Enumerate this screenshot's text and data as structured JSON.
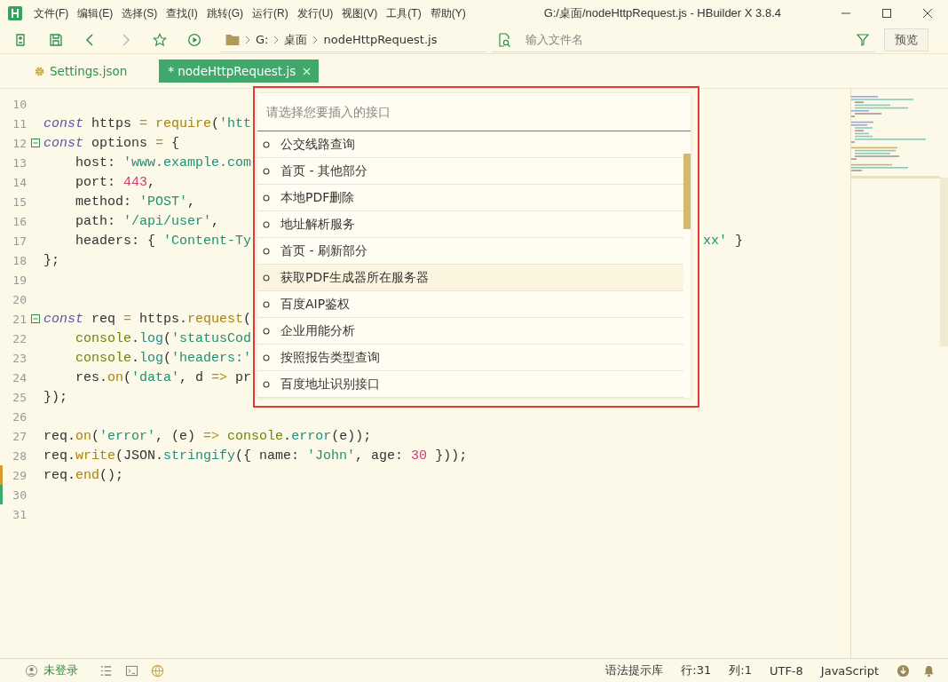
{
  "window": {
    "title": "G:/桌面/nodeHttpRequest.js - HBuilder X 3.8.4"
  },
  "menu": [
    "文件(F)",
    "编辑(E)",
    "选择(S)",
    "查找(I)",
    "跳转(G)",
    "运行(R)",
    "发行(U)",
    "视图(V)",
    "工具(T)",
    "帮助(Y)"
  ],
  "breadcrumb": [
    "G:",
    "桌面",
    "nodeHttpRequest.js"
  ],
  "file_search": {
    "placeholder": "输入文件名"
  },
  "preview_button": "预览",
  "tabs": [
    {
      "label": "Settings.json",
      "selected": false
    },
    {
      "label": "* nodeHttpRequest.js",
      "selected": true
    }
  ],
  "code_lines": [
    {
      "number": "10"
    },
    {
      "number": "11",
      "tokens": [
        {
          "kind": "kw",
          "t": "const"
        },
        {
          "kind": "id",
          "t": " https "
        },
        {
          "kind": "op",
          "t": "="
        },
        {
          "kind": "fn",
          "t": " require"
        },
        {
          "kind": "id",
          "t": "("
        },
        {
          "kind": "str",
          "t": "'htt"
        }
      ]
    },
    {
      "number": "12",
      "fold": true,
      "tokens": [
        {
          "kind": "kw",
          "t": "const"
        },
        {
          "kind": "id",
          "t": " options "
        },
        {
          "kind": "op",
          "t": "="
        },
        {
          "kind": "id",
          "t": " {"
        }
      ]
    },
    {
      "number": "13",
      "tokens": [
        {
          "kind": "id",
          "t": "    host: "
        },
        {
          "kind": "str",
          "t": "'www.example.com"
        }
      ]
    },
    {
      "number": "14",
      "tokens": [
        {
          "kind": "id",
          "t": "    port: "
        },
        {
          "kind": "num",
          "t": "443"
        },
        {
          "kind": "id",
          "t": ","
        }
      ]
    },
    {
      "number": "15",
      "tokens": [
        {
          "kind": "id",
          "t": "    method: "
        },
        {
          "kind": "str",
          "t": "'POST'"
        },
        {
          "kind": "id",
          "t": ","
        }
      ]
    },
    {
      "number": "16",
      "tokens": [
        {
          "kind": "id",
          "t": "    path: "
        },
        {
          "kind": "str",
          "t": "'/api/user'"
        },
        {
          "kind": "id",
          "t": ","
        }
      ]
    },
    {
      "number": "17",
      "tokens": [
        {
          "kind": "id",
          "t": "    headers: { "
        },
        {
          "kind": "str",
          "t": "'Content-Ty"
        }
      ],
      "tail": [
        {
          "kind": "str",
          "t": "xx'"
        },
        {
          "kind": "id",
          "t": " }"
        }
      ]
    },
    {
      "number": "18",
      "tokens": [
        {
          "kind": "id",
          "t": "};"
        }
      ]
    },
    {
      "number": "19"
    },
    {
      "number": "20"
    },
    {
      "number": "21",
      "fold": true,
      "tokens": [
        {
          "kind": "kw",
          "t": "const"
        },
        {
          "kind": "id",
          "t": " req "
        },
        {
          "kind": "op",
          "t": "="
        },
        {
          "kind": "id",
          "t": " https."
        },
        {
          "kind": "fn",
          "t": "request"
        },
        {
          "kind": "id",
          "t": "("
        }
      ]
    },
    {
      "number": "22",
      "tokens": [
        {
          "kind": "obj",
          "t": "    console"
        },
        {
          "kind": "id",
          "t": "."
        },
        {
          "kind": "fn2",
          "t": "log"
        },
        {
          "kind": "id",
          "t": "("
        },
        {
          "kind": "str",
          "t": "'statusCod"
        }
      ]
    },
    {
      "number": "23",
      "tokens": [
        {
          "kind": "obj",
          "t": "    console"
        },
        {
          "kind": "id",
          "t": "."
        },
        {
          "kind": "fn2",
          "t": "log"
        },
        {
          "kind": "id",
          "t": "("
        },
        {
          "kind": "str",
          "t": "'headers:'"
        }
      ]
    },
    {
      "number": "24",
      "tokens": [
        {
          "kind": "id",
          "t": "    res."
        },
        {
          "kind": "fn",
          "t": "on"
        },
        {
          "kind": "id",
          "t": "("
        },
        {
          "kind": "str",
          "t": "'data'"
        },
        {
          "kind": "id",
          "t": ", d "
        },
        {
          "kind": "op",
          "t": "=>"
        },
        {
          "kind": "id",
          "t": " pr"
        }
      ]
    },
    {
      "number": "25",
      "tokens": [
        {
          "kind": "id",
          "t": "});"
        }
      ]
    },
    {
      "number": "26"
    },
    {
      "number": "27",
      "tokens": [
        {
          "kind": "id",
          "t": "req."
        },
        {
          "kind": "fn",
          "t": "on"
        },
        {
          "kind": "id",
          "t": "("
        },
        {
          "kind": "str",
          "t": "'error'"
        },
        {
          "kind": "id",
          "t": ", (e) "
        },
        {
          "kind": "op",
          "t": "=>"
        },
        {
          "kind": "obj",
          "t": " console"
        },
        {
          "kind": "id",
          "t": "."
        },
        {
          "kind": "fn2",
          "t": "error"
        },
        {
          "kind": "id",
          "t": "(e));"
        }
      ]
    },
    {
      "number": "28",
      "tokens": [
        {
          "kind": "id",
          "t": "req."
        },
        {
          "kind": "fn",
          "t": "write"
        },
        {
          "kind": "id",
          "t": "(JSON."
        },
        {
          "kind": "fn2",
          "t": "stringify"
        },
        {
          "kind": "id",
          "t": "({ name: "
        },
        {
          "kind": "str",
          "t": "'John'"
        },
        {
          "kind": "id",
          "t": ", age: "
        },
        {
          "kind": "num",
          "t": "30"
        },
        {
          "kind": "id",
          "t": " }));"
        }
      ]
    },
    {
      "number": "29",
      "kind": "modified",
      "tokens": [
        {
          "kind": "id",
          "t": "req."
        },
        {
          "kind": "fn",
          "t": "end"
        },
        {
          "kind": "id",
          "t": "();"
        }
      ]
    },
    {
      "number": "30",
      "kind": "added"
    },
    {
      "number": "31"
    }
  ],
  "popup": {
    "placeholder": "请选择您要插入的接口",
    "items": [
      {
        "label": "公交线路查询",
        "selected": false
      },
      {
        "label": "首页  -  其他部分",
        "selected": false
      },
      {
        "label": "本地PDF删除",
        "selected": false
      },
      {
        "label": "地址解析服务",
        "selected": false
      },
      {
        "label": "首页  -  刷新部分",
        "selected": false
      },
      {
        "label": "获取PDF生成器所在服务器",
        "selected": true
      },
      {
        "label": "百度AIP鉴权",
        "selected": false
      },
      {
        "label": "企业用能分析",
        "selected": false
      },
      {
        "label": "按照报告类型查询",
        "selected": false
      },
      {
        "label": "百度地址识别接口",
        "selected": false
      }
    ]
  },
  "status_bar": {
    "login": "未登录",
    "syntax_library": "语法提示库",
    "line": "行:31",
    "column": "列:1",
    "encoding": "UTF-8",
    "language": "JavaScript"
  }
}
